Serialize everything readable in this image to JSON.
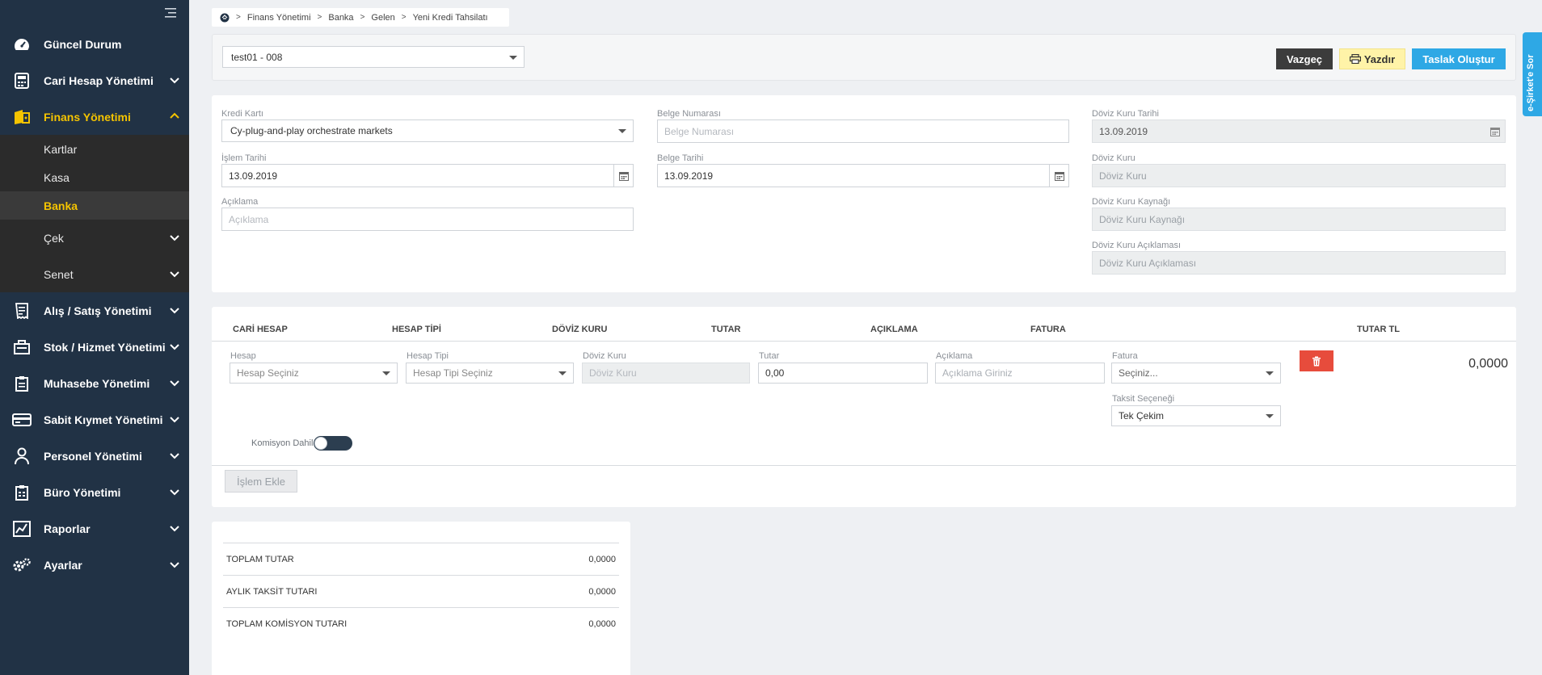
{
  "sidebar": {
    "items": [
      {
        "label": "Güncel Durum",
        "icon": "dashboard-icon"
      },
      {
        "label": "Cari Hesap Yönetimi",
        "icon": "calculator-icon"
      },
      {
        "label": "Finans Yönetimi",
        "icon": "finance-icon"
      },
      {
        "label": "Alış / Satış Yönetimi",
        "icon": "receipt-icon"
      },
      {
        "label": "Stok / Hizmet Yönetimi",
        "icon": "stock-icon"
      },
      {
        "label": "Muhasebe Yönetimi",
        "icon": "clipboard-icon"
      },
      {
        "label": "Sabit Kıymet Yönetimi",
        "icon": "card-icon"
      },
      {
        "label": "Personel Yönetimi",
        "icon": "person-icon"
      },
      {
        "label": "Büro Yönetimi",
        "icon": "office-icon"
      },
      {
        "label": "Raporlar",
        "icon": "chart-icon"
      },
      {
        "label": "Ayarlar",
        "icon": "gears-icon"
      }
    ],
    "finance_sub": [
      {
        "label": "Kartlar"
      },
      {
        "label": "Kasa"
      },
      {
        "label": "Banka"
      },
      {
        "label": "Çek"
      },
      {
        "label": "Senet"
      }
    ]
  },
  "breadcrumb": [
    "Finans Yönetimi",
    "Banka",
    "Gelen",
    "Yeni Kredi Tahsilatı"
  ],
  "topbar": {
    "selected": "test01 - 008",
    "cancel": "Vazgeç",
    "print": "Yazdır",
    "draft": "Taslak Oluştur"
  },
  "form": {
    "kredi_karti_label": "Kredi Kartı",
    "kredi_karti_value": "Cy-plug-and-play orchestrate markets",
    "islem_tarihi_label": "İşlem Tarihi",
    "islem_tarihi_value": "13.09.2019",
    "aciklama_label": "Açıklama",
    "aciklama_placeholder": "Açıklama",
    "belge_no_label": "Belge Numarası",
    "belge_no_placeholder": "Belge Numarası",
    "belge_tarihi_label": "Belge Tarihi",
    "belge_tarihi_value": "13.09.2019",
    "doviz_kuru_tarihi_label": "Döviz Kuru Tarihi",
    "doviz_kuru_tarihi_value": "13.09.2019",
    "doviz_kuru_label": "Döviz Kuru",
    "doviz_kuru_placeholder": "Döviz Kuru",
    "doviz_kaynak_label": "Döviz Kuru Kaynağı",
    "doviz_kaynak_placeholder": "Döviz Kuru Kaynağı",
    "doviz_aciklama_label": "Döviz Kuru Açıklaması",
    "doviz_aciklama_placeholder": "Döviz Kuru Açıklaması"
  },
  "lines": {
    "headers": [
      "CARİ HESAP",
      "HESAP TİPİ",
      "DÖVİZ KURU",
      "TUTAR",
      "AÇIKLAMA",
      "FATURA",
      "TUTAR TL"
    ],
    "row": {
      "hesap_label": "Hesap",
      "hesap_value": "Hesap Seçiniz",
      "hesap_tipi_label": "Hesap Tipi",
      "hesap_tipi_value": "Hesap Tipi Seçiniz",
      "doviz_label": "Döviz Kuru",
      "doviz_placeholder": "Döviz Kuru",
      "tutar_label": "Tutar",
      "tutar_value": "0,00",
      "aciklama_label": "Açıklama",
      "aciklama_placeholder": "Açıklama Giriniz",
      "fatura_label": "Fatura",
      "fatura_value": "Seçiniz...",
      "taksit_label": "Taksit Seçeneği",
      "taksit_value": "Tek Çekim",
      "tutar_tl": "0,0000",
      "komisyon_label": "Komisyon Dahil"
    },
    "add_button": "İşlem Ekle"
  },
  "totals": [
    {
      "label": "TOPLAM TUTAR",
      "value": "0,0000"
    },
    {
      "label": "AYLIK TAKSİT TUTARI",
      "value": "0,0000"
    },
    {
      "label": "TOPLAM KOMİSYON TUTARI",
      "value": "0,0000"
    }
  ],
  "side_tab": "e-Şirket'e Sor",
  "colors": {
    "sidebar_bg": "#213245",
    "accent_yellow": "#f5c400",
    "blue": "#2ea8e5",
    "danger": "#e74c3c"
  }
}
